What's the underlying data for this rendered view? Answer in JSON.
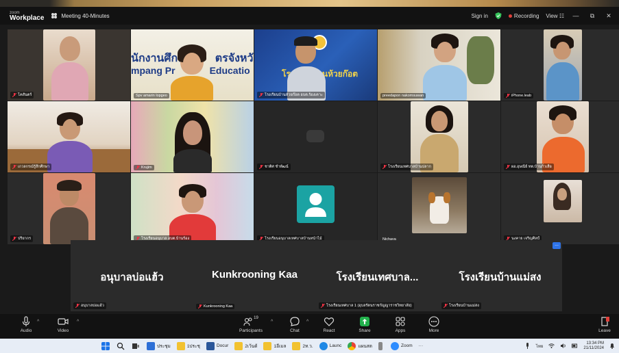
{
  "window": {
    "brand_line1": "zoom",
    "brand_line2": "Workplace",
    "meeting_title": "Meeting 40-Minutes",
    "sign_in": "Sign in",
    "recording": "Recording",
    "view": "View",
    "view_icon": "☷",
    "minimize": "—",
    "restore": "⧉",
    "close": "✕"
  },
  "participants": [
    {
      "name": "โคสันตร์",
      "muted": true
    },
    {
      "name": "Spv amarin lopgeo",
      "muted": false,
      "active": true,
      "sign_text_1": "นักงานศึกษ",
      "sign_text_2": "ตรจังหวัด",
      "sign_text_3": "mpang Pr",
      "sign_text_4": "Educatio"
    },
    {
      "name": "โรงเรียนบ้านห้วยก๊อต อบต.ร้องเคาะ",
      "muted": true,
      "sign_text_1": "โรงเรียนบ้านห้วยก๊อต"
    },
    {
      "name": "preedapon nakomsuwan",
      "muted": false
    },
    {
      "name": "iPhone.leab",
      "muted": true
    },
    {
      "name": "เกวลกรณ์รู้สึกศึกษา",
      "muted": true
    },
    {
      "name": "Krujim",
      "muted": true
    },
    {
      "name": "ชาติศ ชำพัฒน์",
      "muted": true
    },
    {
      "name": "โรงเรียนเทศบาลบ้านปลาก",
      "muted": true
    },
    {
      "name": "ผอ.อุษณีย์ ทต.บ้านกิ่วเสือ",
      "muted": true
    },
    {
      "name": "ปริยากร",
      "muted": true
    },
    {
      "name": "โรงเรียนอนุบาล อบต.บ้านร้อง",
      "muted": true
    },
    {
      "name": "โรงเรียนอนุบาลเทศบาลบ้านหน้าไม้",
      "muted": true
    },
    {
      "name": "Nichaya",
      "muted": false
    },
    {
      "name": "นงคาย เจริญศิลป์",
      "muted": true
    }
  ],
  "text_tiles": [
    {
      "display": "อนุบาลบ่อแฮ้ว",
      "name": "อนุบาลบ่อแฮ้ว"
    },
    {
      "display": "Kunkrooning Kaa",
      "name": "Kunkrooning Kaa"
    },
    {
      "display": "โรงเรียนเทศบาล...",
      "name": "โรงเรียนเทศบาล 1 (อุบลรัตนราชกัญญาราชวิทยาลัย)"
    },
    {
      "display": "โรงเรียนบ้านแม่สง",
      "name": "โรงเรียนบ้านแม่สง"
    }
  ],
  "more_badge": "...",
  "toolbar": {
    "audio": "Audio",
    "video": "Video",
    "participants": "Participants",
    "participants_count": "19",
    "chat": "Chat",
    "react": "React",
    "share": "Share",
    "apps": "Apps",
    "more": "More",
    "leave": "Leave",
    "caret": "^"
  },
  "taskbar": {
    "items": [
      "ประชุม",
      "1ประชุ",
      "Docur",
      "2เว้นด้",
      "1อีเมล",
      "2ท.ว.",
      "Launc",
      "แผนสต",
      "Zoom"
    ],
    "overflow": "···",
    "lang": "ไทย",
    "time": "13:34 PM",
    "date": "21/11/2024"
  },
  "colors": {
    "active_speaker": "#36c35a",
    "recording": "#e0403a",
    "share": "#22b14c",
    "badge": "#2f74e8"
  }
}
